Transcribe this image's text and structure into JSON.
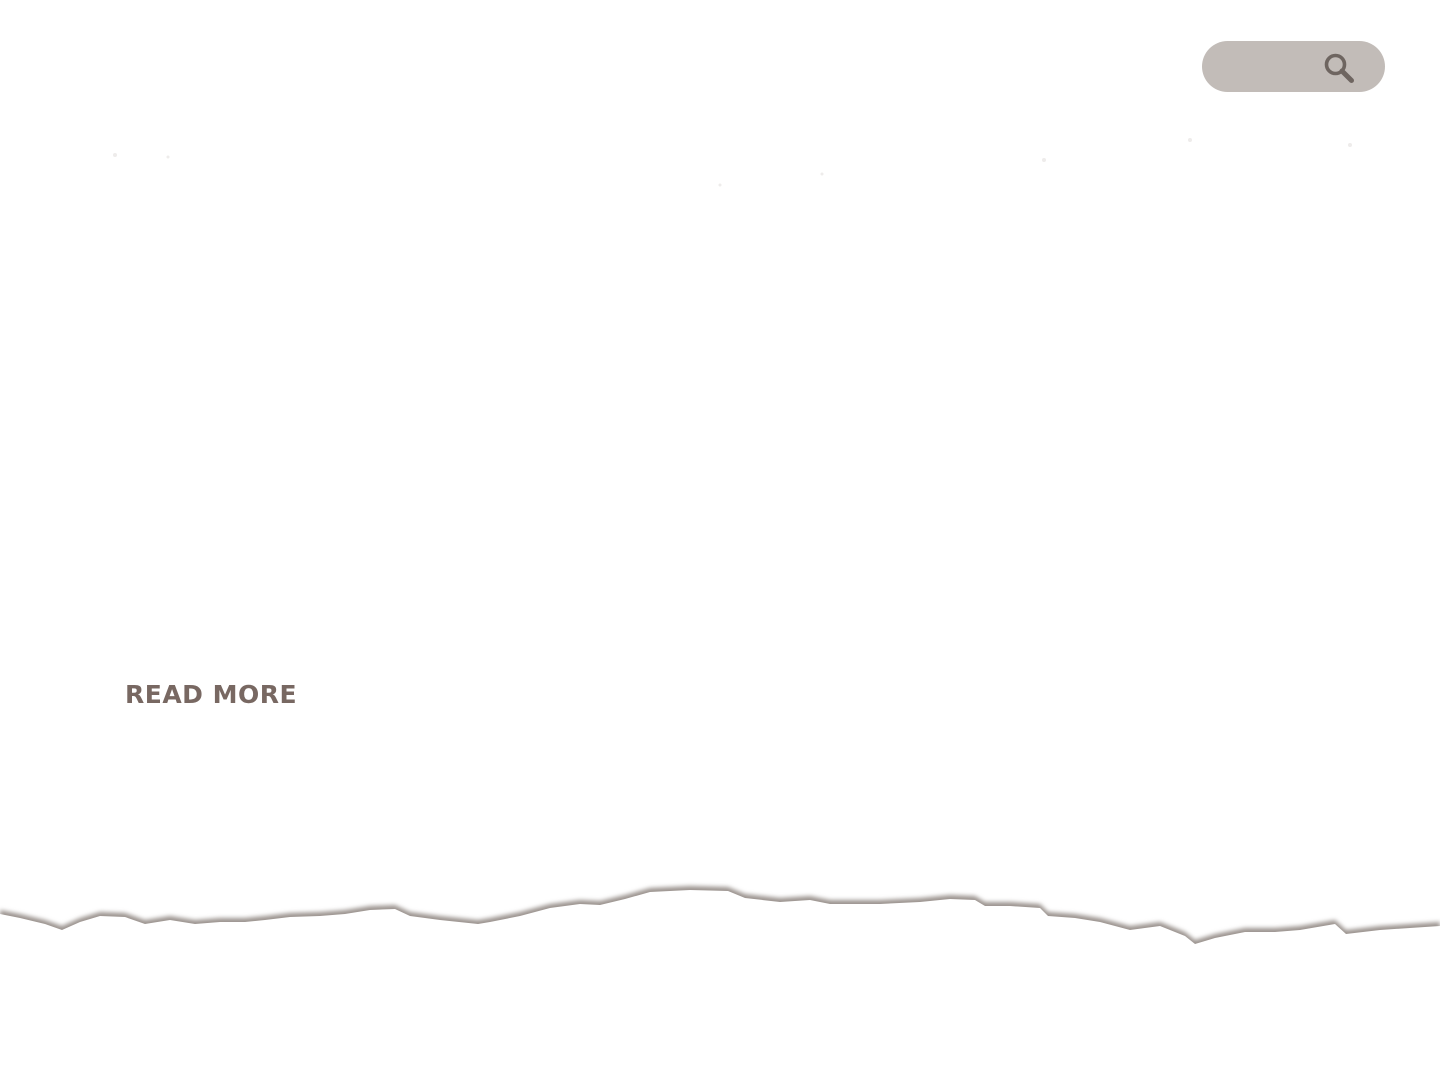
{
  "search": {
    "value": "",
    "placeholder": "",
    "icon": "search-icon"
  },
  "content": {
    "read_more_label": "READ MORE"
  },
  "colors": {
    "search_background": "#c2bcb8",
    "search_icon": "#6e6560",
    "link_text": "#786862",
    "torn_edge_shadow": "#9c9490"
  }
}
